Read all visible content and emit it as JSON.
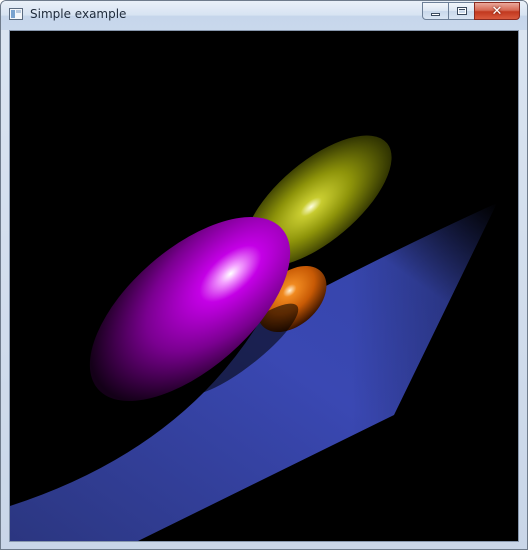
{
  "window": {
    "title": "Simple example",
    "icon": "application-window-icon",
    "buttons": {
      "minimize": "minimize-icon",
      "maximize": "maximize-icon",
      "close": "close-icon"
    }
  },
  "scene": {
    "background_color": "#000000",
    "objects": [
      {
        "name": "blue-plane",
        "color": "#3f4fc0"
      },
      {
        "name": "olive-ellipsoid",
        "color": "#9aa00a"
      },
      {
        "name": "orange-ellipsoid",
        "color": "#e06c08"
      },
      {
        "name": "magenta-ellipsoid",
        "color": "#c200e0"
      }
    ]
  }
}
